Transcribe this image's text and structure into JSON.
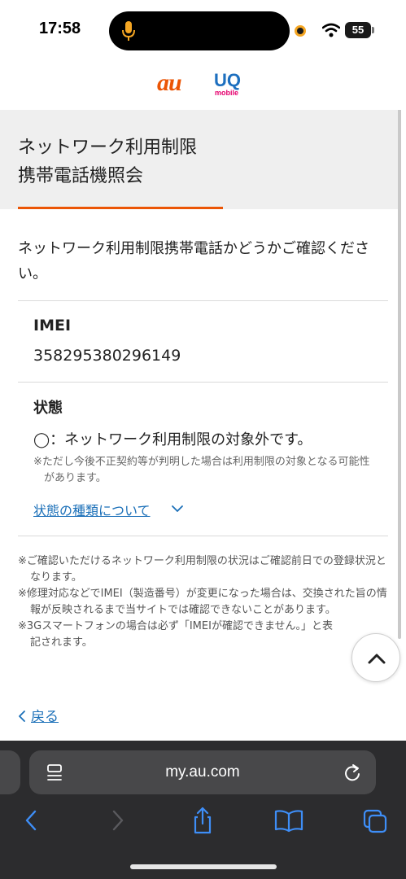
{
  "status_bar": {
    "time": "17:58",
    "battery": "55"
  },
  "logo": {
    "au": "au",
    "uq": "UQ",
    "uq_sub": "mobile"
  },
  "title": {
    "line1": "ネットワーク利用制限",
    "line2": "携帯電話機照会"
  },
  "lead": "ネットワーク利用制限携帯電話かどうかご確認ください。",
  "imei": {
    "label": "IMEI",
    "value": "358295380296149"
  },
  "status": {
    "label": "状態",
    "value": "◯：ネットワーク利用制限の対象外です。",
    "note": "※ただし今後不正契約等が判明した場合は利用制限の対象となる可能性があります。",
    "link": "状態の種類について"
  },
  "notes": [
    "※ご確認いただけるネットワーク利用制限の状況はご確認前日での登録状況となります。",
    "※修理対応などでIMEI（製造番号）が変更になった場合は、交換された旨の情報が反映されるまで当サイトでは確認できないことがあります。",
    "※3Gスマートフォンの場合は必ず「IMEIが確認できません。」と表記されます。"
  ],
  "back": {
    "label": "戻る"
  },
  "browser": {
    "url": "my.au.com"
  },
  "colors": {
    "accent": "#eb5505",
    "link": "#1a6fb8",
    "title_bg": "#efefef"
  }
}
